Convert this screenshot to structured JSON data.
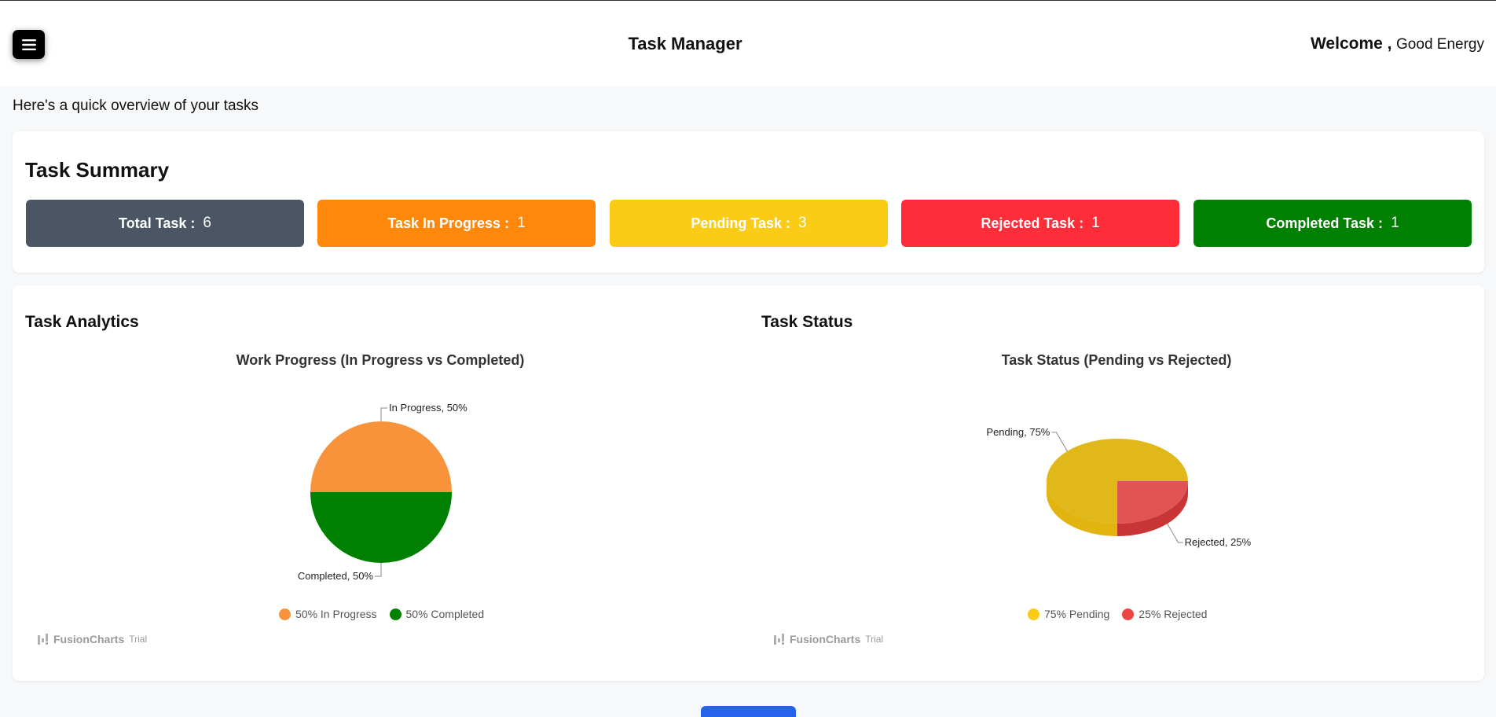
{
  "header": {
    "title": "Task Manager",
    "welcome_label": "Welcome ,",
    "user_name": "Good Energy"
  },
  "overview_text": "Here's a quick overview of your tasks",
  "summary": {
    "title": "Task Summary",
    "stats": [
      {
        "label": "Total Task :",
        "value": "6",
        "color": "#4b5563"
      },
      {
        "label": "Task In Progress :",
        "value": "1",
        "color": "#ff870a"
      },
      {
        "label": "Pending Task :",
        "value": "3",
        "color": "#facc15"
      },
      {
        "label": "Rejected Task :",
        "value": "1",
        "color": "#ff2d3a"
      },
      {
        "label": "Completed Task :",
        "value": "1",
        "color": "#008000"
      }
    ]
  },
  "analytics": {
    "title": "Task Analytics",
    "status_title": "Task Status",
    "watermark_brand": "FusionCharts",
    "watermark_trial": "Trial"
  },
  "chart_data": [
    {
      "type": "pie",
      "title": "Work Progress (In Progress vs Completed)",
      "categories": [
        "In Progress",
        "Completed"
      ],
      "values": [
        50,
        50
      ],
      "colors": [
        "#f9933b",
        "#008000"
      ],
      "data_labels": [
        "In Progress, 50%",
        "Completed, 50%"
      ],
      "legend": [
        "50% In Progress",
        "50% Completed"
      ],
      "legend_position": "bottom"
    },
    {
      "type": "pie",
      "title": "Task Status (Pending vs Rejected)",
      "categories": [
        "Pending",
        "Rejected"
      ],
      "values": [
        75,
        25
      ],
      "colors": [
        "#facc15",
        "#ef4444"
      ],
      "data_labels": [
        "Pending, 75%",
        "Rejected, 25%"
      ],
      "legend": [
        "75% Pending",
        "25% Rejected"
      ],
      "legend_position": "bottom",
      "style": "3d"
    }
  ]
}
